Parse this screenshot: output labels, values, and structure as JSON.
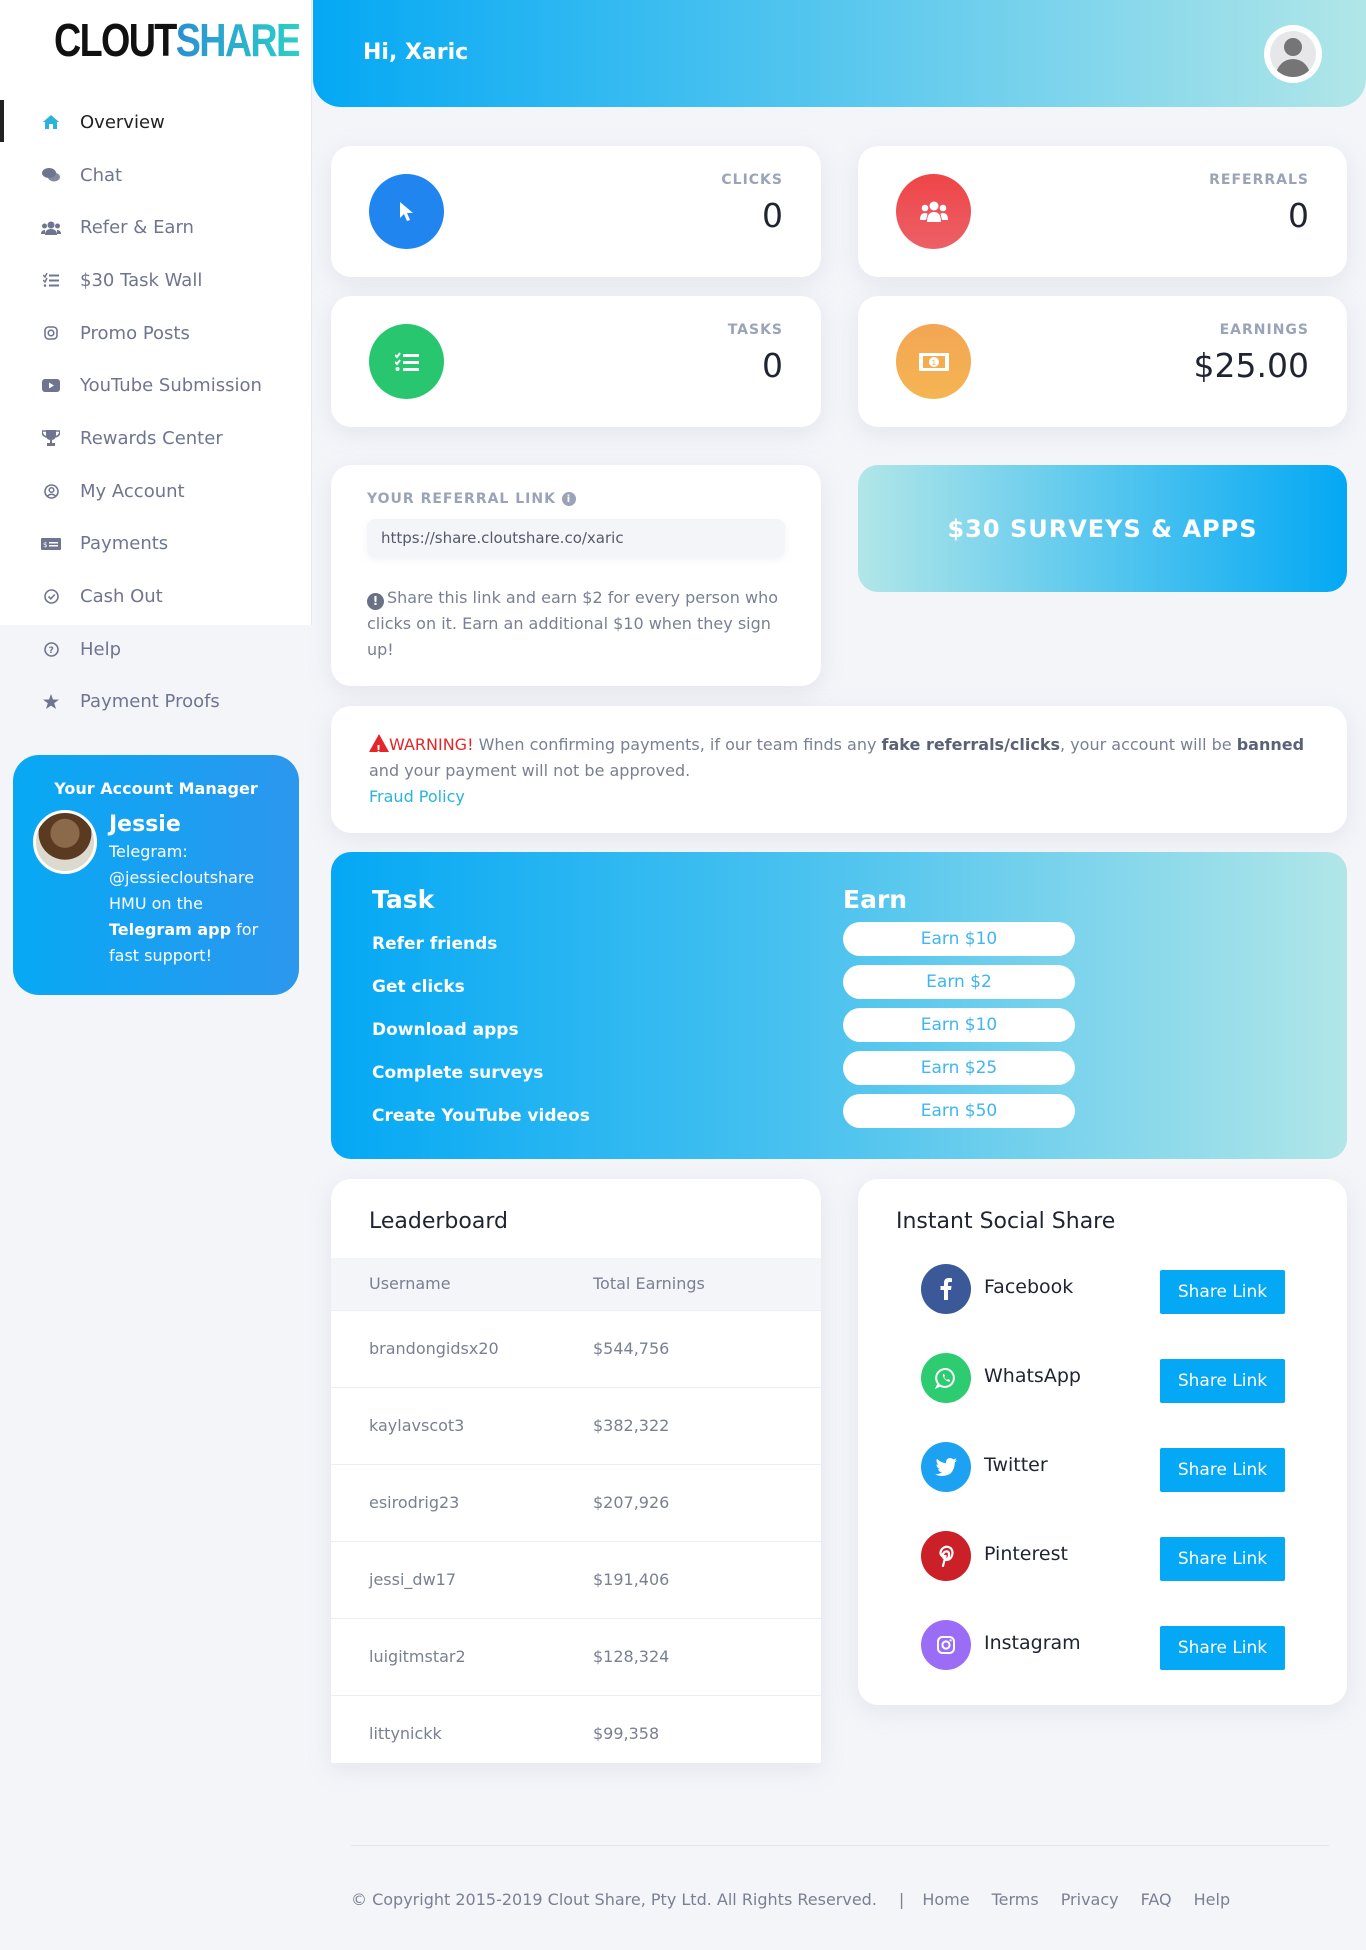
{
  "brand": {
    "part1": "CLOUT",
    "part2": "SHARE"
  },
  "sidebar": {
    "items": [
      {
        "label": "Overview",
        "icon": "home-icon",
        "active": true
      },
      {
        "label": "Chat",
        "icon": "chat-bubbles-icon"
      },
      {
        "label": "Refer & Earn",
        "icon": "users-icon"
      },
      {
        "label": "$30 Task Wall",
        "icon": "task-list-icon"
      },
      {
        "label": "Promo Posts",
        "icon": "instagram-icon"
      },
      {
        "label": "YouTube Submission",
        "icon": "youtube-icon"
      },
      {
        "label": "Rewards Center",
        "icon": "trophy-icon"
      },
      {
        "label": "My Account",
        "icon": "user-circle-icon"
      },
      {
        "label": "Payments",
        "icon": "money-check-icon"
      },
      {
        "label": "Cash Out",
        "icon": "check-circle-icon"
      },
      {
        "label": "Help",
        "icon": "question-circle-icon"
      },
      {
        "label": "Payment Proofs",
        "icon": "star-icon"
      }
    ]
  },
  "account_manager": {
    "title": "Your Account Manager",
    "name": "Jessie",
    "line1": "Telegram:",
    "line2": "@jessiecloutshare",
    "line3": "HMU on the",
    "bold": "Telegram app",
    "line4": " for",
    "line5": "fast support!"
  },
  "header": {
    "greeting": "Hi, Xaric"
  },
  "stats": {
    "clicks": {
      "label": "CLICKS",
      "value": "0",
      "color": "#2185f0"
    },
    "referrals": {
      "label": "REFERRALS",
      "value": "0",
      "color": "#ef4b4f"
    },
    "tasks": {
      "label": "TASKS",
      "value": "0",
      "color": "#28c76f"
    },
    "earnings": {
      "label": "EARNINGS",
      "value": "$25.00",
      "color": "#f5aa52"
    }
  },
  "referral": {
    "title": "YOUR REFERRAL LINK",
    "link": "https://share.cloutshare.co/xaric",
    "note": "Share this link and earn $2 for every person who clicks on it. Earn an additional $10 when they sign up!"
  },
  "surveys_button": "$30 SURVEYS & APPS",
  "warning": {
    "label": "WARNING!",
    "text1": " When confirming payments, if our team finds any ",
    "bold1": "fake referrals/clicks",
    "text2": ", your account will be ",
    "bold2": "banned",
    "text3": " and your payment will not be approved.",
    "link": "Fraud Policy"
  },
  "task_table": {
    "task_header": "Task",
    "earn_header": "Earn",
    "rows": [
      {
        "task": "Refer friends",
        "earn": "Earn $10"
      },
      {
        "task": "Get clicks",
        "earn": "Earn $2"
      },
      {
        "task": "Download apps",
        "earn": "Earn $10"
      },
      {
        "task": "Complete surveys",
        "earn": "Earn $25"
      },
      {
        "task": "Create YouTube videos",
        "earn": "Earn $50"
      }
    ]
  },
  "leaderboard": {
    "title": "Leaderboard",
    "columns": [
      "Username",
      "Total Earnings"
    ],
    "rows": [
      [
        "brandongidsx20",
        "$544,756"
      ],
      [
        "kaylavscot3",
        "$382,322"
      ],
      [
        "esirodrig23",
        "$207,926"
      ],
      [
        "jessi_dw17",
        "$191,406"
      ],
      [
        "luigitmstar2",
        "$128,324"
      ],
      [
        "littynickk",
        "$99,358"
      ]
    ]
  },
  "social": {
    "title": "Instant Social Share",
    "button_label": "Share Link",
    "items": [
      {
        "name": "Facebook",
        "glyph": "f",
        "color": "#3b5998"
      },
      {
        "name": "WhatsApp",
        "glyph": "✆",
        "color": "#2ecc71"
      },
      {
        "name": "Twitter",
        "glyph": "🐦",
        "color": "#1da1f2"
      },
      {
        "name": "Pinterest",
        "glyph": "P",
        "color": "#cb2027"
      },
      {
        "name": "Instagram",
        "glyph": "◎",
        "color": "#9b6cf5"
      }
    ]
  },
  "footer": {
    "copyright": "© Copyright 2015-2019 Clout Share, Pty Ltd. All Rights Reserved.",
    "separator": "|",
    "links": [
      "Home",
      "Terms",
      "Privacy",
      "FAQ",
      "Help"
    ]
  }
}
